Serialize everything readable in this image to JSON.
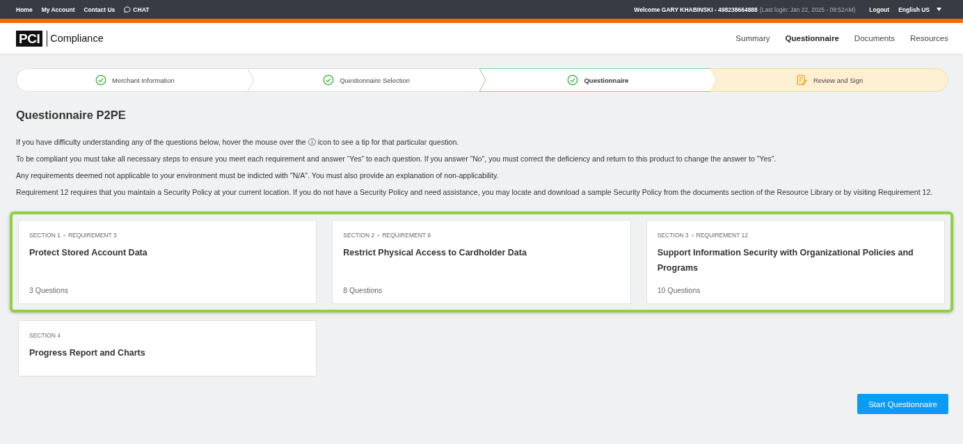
{
  "top_bar": {
    "links": [
      {
        "label": "Home",
        "kind": "plain"
      },
      {
        "label": "My Account",
        "kind": "plain"
      },
      {
        "label": "Contact Us",
        "kind": "plain"
      },
      {
        "label": "CHAT",
        "kind": "chat"
      }
    ],
    "welcome": "Welcome GARY KHABINSKI - 498238664888",
    "last_login": "(Last login: Jan 22, 2025 - 09:52AM)",
    "logout": "Logout",
    "language": "English US"
  },
  "header": {
    "logo_mark": "PCI",
    "logo_text": "Compliance",
    "nav": [
      {
        "label": "Summary",
        "selected": false
      },
      {
        "label": "Questionnaire",
        "selected": true
      },
      {
        "label": "Documents",
        "selected": false
      },
      {
        "label": "Resources",
        "selected": false
      }
    ]
  },
  "steps": [
    {
      "label": "Merchant Information",
      "kind": "complete",
      "selected": false
    },
    {
      "label": "Questionnaire Selection",
      "kind": "complete",
      "selected": false
    },
    {
      "label": "Questionnaire",
      "kind": "complete",
      "selected": true
    },
    {
      "label": "Review and Sign",
      "kind": "pending",
      "selected": false
    }
  ],
  "title": "Questionnaire P2PE",
  "instructions": [
    "If you have difficulty understanding any of the questions below, hover the mouse over the ⓘ icon to see a tip for that particular question.",
    "To be compliant you must take all necessary steps to ensure you meet each requirement and answer “Yes” to each question. If you answer ”No”, you must correct the deficiency and return to this product to change the answer to ”Yes”.",
    "Any requirements deemed not applicable to your environment must be indicted with \"N/A\". You must also provide an explanation of non-applicability.",
    "Requirement 12 requires that you maintain a Security Policy at your current location. If you do not have a Security Policy and need assistance, you may locate and download a sample Security Policy from the documents section of the Resource Library or by visiting Requirement 12."
  ],
  "section_rows": [
    {
      "highlighted": true,
      "cards": [
        {
          "section": "SECTION 1",
          "requirement": "REQUIREMENT 3",
          "title": "Protect Stored Account Data",
          "questions": "3 Questions"
        },
        {
          "section": "SECTION 2",
          "requirement": "REQUIREMENT 9",
          "title": "Restrict Physical Access to Cardholder Data",
          "questions": "8 Questions"
        },
        {
          "section": "SECTION 3",
          "requirement": "REQUIREMENT 12",
          "title": "Support Information Security with Organizational Policies and Programs",
          "questions": "10 Questions"
        }
      ]
    },
    {
      "highlighted": false,
      "cards": [
        {
          "section": "SECTION 4",
          "title": "Progress Report and Charts"
        }
      ]
    }
  ],
  "start_button": "Start Questionnaire"
}
